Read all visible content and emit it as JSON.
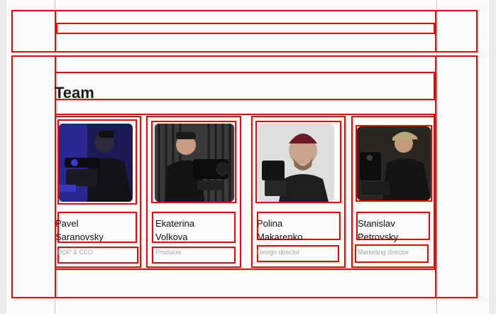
{
  "team": {
    "title": "Team",
    "members": [
      {
        "first_name": "Pavel",
        "last_name": "Saranovsky",
        "role": "DOP & CEO"
      },
      {
        "first_name": "Ekaterina",
        "last_name": "Volkova",
        "role": "Producer"
      },
      {
        "first_name": "Polina",
        "last_name": "Makarenko",
        "role": "Design director"
      },
      {
        "first_name": "Stanislav",
        "last_name": "Petrovsky",
        "role": "Marketing director"
      }
    ]
  },
  "colors": {
    "annotation": "#ff0000",
    "guide": "#f3b5b5",
    "page_bg": "#fbfbfb"
  }
}
